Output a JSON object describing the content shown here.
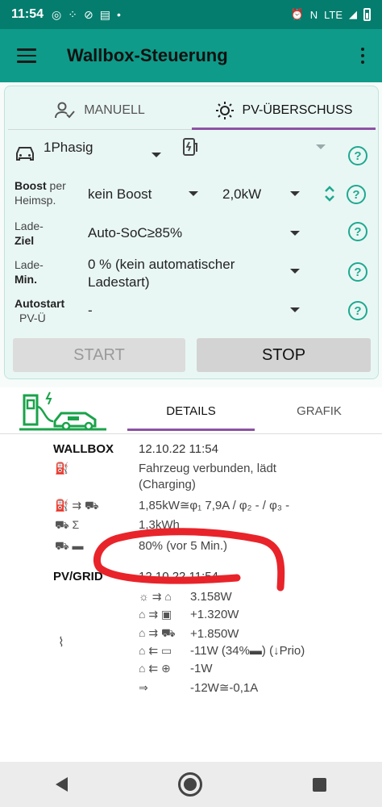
{
  "statusbar": {
    "time": "11:54",
    "network": "LTE"
  },
  "appbar": {
    "title": "Wallbox-Steuerung"
  },
  "mode_tabs": [
    {
      "label": "MANUELL"
    },
    {
      "label": "PV-ÜBERSCHUSS"
    }
  ],
  "controls": {
    "phase": "1Phasig",
    "boost_label_main": "Boost",
    "boost_label_rest": " per",
    "boost_label_line2": "Heimsp.",
    "boost_value": "kein Boost",
    "power_value": "2,0kW",
    "ladeziel_line1": "Lade-",
    "ladeziel_line2": "Ziel",
    "ladeziel_value": "Auto-SoC≥85%",
    "lademin_line1": "Lade-",
    "lademin_line2": "Min.",
    "lademin_value_1": "0 % (kein automatischer",
    "lademin_value_2": "Ladestart)",
    "autostart_line1": "Autostart",
    "autostart_line2": "PV-Ü",
    "autostart_value": "-",
    "help_glyph": "?",
    "start_label": "START",
    "stop_label": "STOP"
  },
  "detail_tabs": [
    {
      "label": "DETAILS"
    },
    {
      "label": "GRAFIK"
    }
  ],
  "wallbox": {
    "title": "WALLBOX",
    "timestamp": "12.10.22 11:54",
    "status_1": "Fahrzeug verbunden, lädt",
    "status_2": "(Charging)",
    "power_line": "1,85kW≅φ₁ 7,9A / φ₂ - / φ₃ -",
    "energy": "1,3kWh",
    "soc": "80% (vor 5 Min.)"
  },
  "pvgrid": {
    "title": "PV/GRID",
    "timestamp": "12.10.22 11:54",
    "lines": [
      {
        "glyph": "☼ ⇉ ⌂",
        "value": "3.158W"
      },
      {
        "glyph": "⌂ ⇉ ▣",
        "value": "+1.320W"
      },
      {
        "glyph": "⌂ ⇉ ⛟",
        "value": "+1.850W"
      },
      {
        "glyph": "⌂ ⇇ ▭",
        "value": "-11W (34%▬) (↓Prio)"
      },
      {
        "glyph": "⌂ ⇇ ⊕",
        "value": "-1W"
      },
      {
        "glyph": "⇒",
        "value": "-12W≅-0,1A"
      }
    ]
  },
  "colors": {
    "statusbar": "#047d6e",
    "appbar": "#0e9b89",
    "accent": "#8d52a4",
    "help": "#1fa890",
    "annotation": "#e8242a"
  }
}
